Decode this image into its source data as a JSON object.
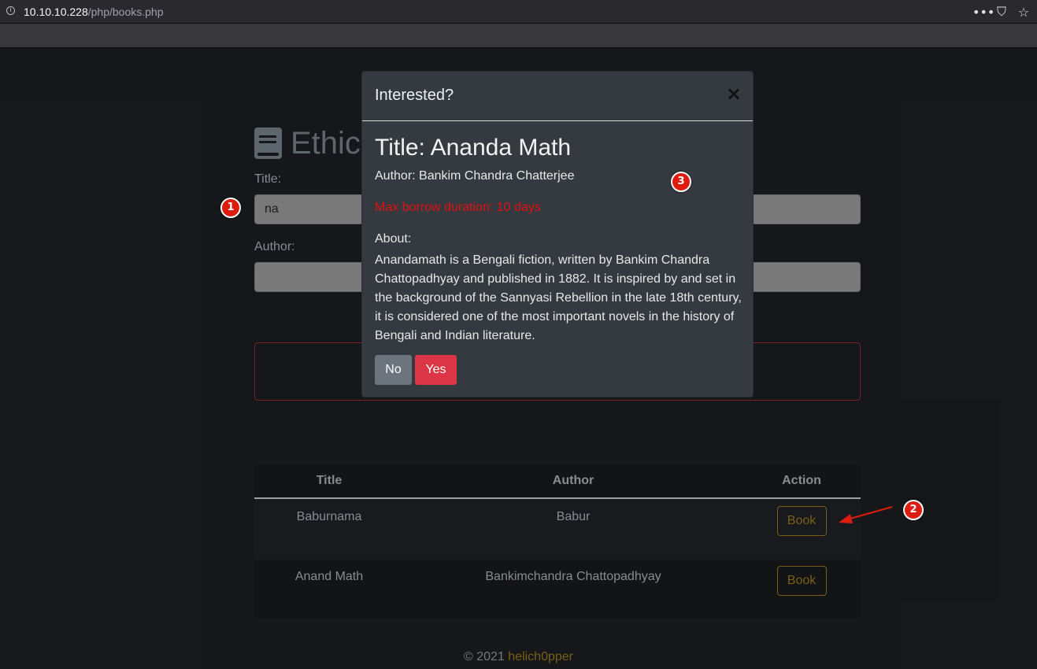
{
  "browser": {
    "url_host": "10.10.10.228",
    "url_path": "/php/books.php",
    "icons": [
      "info-icon",
      "more-icon",
      "pocket-icon",
      "star-icon"
    ]
  },
  "page": {
    "title_visible": "Ethic",
    "title_label": "Title:",
    "title_value": "na",
    "author_label": "Author:",
    "author_value": ""
  },
  "table": {
    "headers": [
      "Title",
      "Author",
      "Action"
    ],
    "rows": [
      {
        "title": "Baburnama",
        "author": "Babur",
        "action": "Book"
      },
      {
        "title": "Anand Math",
        "author": "Bankimchandra Chattopadhyay",
        "action": "Book"
      }
    ]
  },
  "footer": {
    "copyright": "© 2021",
    "author": "helich0pper"
  },
  "modal": {
    "header": "Interested?",
    "close": "×",
    "book_title": "Title: Ananda Math",
    "book_author": "Author: Bankim Chandra Chatterjee",
    "duration": "Max borrow duration: 10 days",
    "about_label": "About:",
    "about_text": "Anandamath is a Bengali fiction, written by Bankim Chandra Chattopadhyay and published in 1882. It is inspired by and set in the background of the Sannyasi Rebellion in the late 18th century, it is considered one of the most important novels in the history of Bengali and Indian literature.",
    "no_label": "No",
    "yes_label": "Yes"
  },
  "annotations": [
    "1",
    "2",
    "3"
  ],
  "colors": {
    "background": "#191b1e",
    "accent_gold": "#8c6d18",
    "danger": "#dc3545",
    "secondary": "#6c757d",
    "annotation_red": "#dd1c0e"
  }
}
